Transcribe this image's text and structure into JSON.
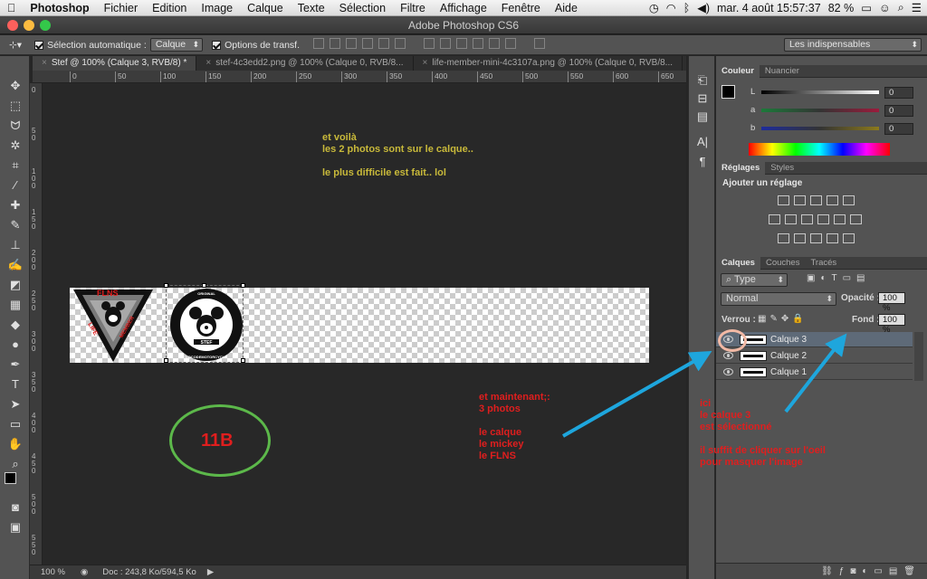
{
  "menubar": {
    "app": "Photoshop",
    "items": [
      "Fichier",
      "Edition",
      "Image",
      "Calque",
      "Texte",
      "Sélection",
      "Filtre",
      "Affichage",
      "Fenêtre",
      "Aide"
    ],
    "datetime": "mar. 4 août  15:57:37",
    "battery": "82 %"
  },
  "window": {
    "title": "Adobe Photoshop CS6"
  },
  "options": {
    "auto_select_label": "Sélection automatique :",
    "auto_select_value": "Calque",
    "transform_label": "Options de transf.",
    "workspace": "Les indispensables"
  },
  "tabs": [
    {
      "label": "Stef @ 100% (Calque 3, RVB/8) *"
    },
    {
      "label": "stef-4c3edd2.png @ 100% (Calque 0, RVB/8..."
    },
    {
      "label": "life-member-mini-4c3107a.png @ 100% (Calque 0, RVB/8..."
    }
  ],
  "ruler": {
    "h": [
      "0",
      "50",
      "100",
      "150",
      "200",
      "250",
      "300",
      "350",
      "400",
      "450",
      "500",
      "550",
      "600",
      "650"
    ],
    "v": [
      "0",
      "5 0",
      "1 0 0",
      "1 5 0",
      "2 0 0",
      "2 5 0",
      "3 0 0",
      "3 5 0",
      "4 0 0",
      "4 5 0",
      "5 0 0",
      "5 5 0"
    ]
  },
  "canvas_annotations": {
    "yellow": "et voilà\nles 2 photos sont sur le calque..\n\nle plus difficile est fait.. lol",
    "red_left": "et maintenant;:\n3 photos\n\nle calque\nle mickey\nle FLNS",
    "red_right": "ici\nle calque 3\nest sélectionné\n\nil suffit de cliquer sur l'oeil\npour masquer l'image",
    "circle_label": "11B"
  },
  "logos": {
    "flns": "FLNS",
    "life": "LIFE",
    "member": "MEMBER",
    "stef": "STEF",
    "original": "ORIGINAL",
    "ring": "LOCODEMOTORCYCLE"
  },
  "status": {
    "zoom": "100 %",
    "doc": "Doc : 243,8 Ko/594,5 Ko"
  },
  "color_panel": {
    "tabs": [
      "Couleur",
      "Nuancier"
    ],
    "labels": [
      "L",
      "a",
      "b"
    ],
    "values": [
      "0",
      "0",
      "0"
    ]
  },
  "adjust_panel": {
    "tabs": [
      "Réglages",
      "Styles"
    ],
    "heading": "Ajouter un réglage"
  },
  "layers_panel": {
    "tabs": [
      "Calques",
      "Couches",
      "Tracés"
    ],
    "filter": "Type",
    "blend": "Normal",
    "opacity_label": "Opacité :",
    "opacity": "100 %",
    "lock_label": "Verrou :",
    "fill_label": "Fond :",
    "fill": "100 %",
    "layers": [
      {
        "name": "Calque 3"
      },
      {
        "name": "Calque 2"
      },
      {
        "name": "Calque 1"
      }
    ]
  },
  "colors": {
    "annotation_yellow": "#c8b93a",
    "annotation_red": "#e01e1e",
    "arrow_blue": "#1ea6dd",
    "circle_green": "#5cb84a",
    "layer_selected": "#5e6a78"
  }
}
